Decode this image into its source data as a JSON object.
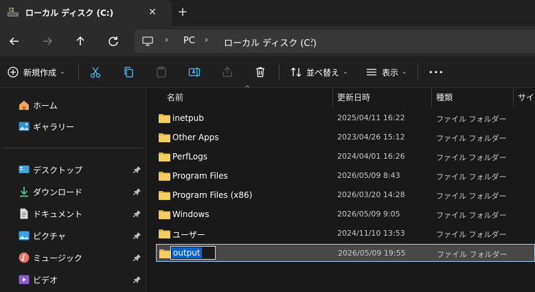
{
  "tab": {
    "title": "ローカル ディスク (C:)",
    "close_glyph": "✕",
    "new_tab_glyph": "+"
  },
  "address": {
    "crumbs": [
      "PC",
      "ローカル ディスク (C:)"
    ],
    "sep": "›"
  },
  "commands": {
    "new_label": "新規作成",
    "sort_label": "並べ替え",
    "view_label": "表示",
    "more_glyph": "•••",
    "caret": "⌄"
  },
  "sidebar": {
    "items": [
      {
        "label": "ホーム",
        "icon": "home-icon",
        "pinned": false
      },
      {
        "label": "ギャラリー",
        "icon": "gallery-icon",
        "pinned": false
      },
      {
        "label": "デスクトップ",
        "icon": "desktop-icon",
        "pinned": true
      },
      {
        "label": "ダウンロード",
        "icon": "download-icon",
        "pinned": true
      },
      {
        "label": "ドキュメント",
        "icon": "document-icon",
        "pinned": true
      },
      {
        "label": "ピクチャ",
        "icon": "pictures-icon",
        "pinned": true
      },
      {
        "label": "ミュージック",
        "icon": "music-icon",
        "pinned": true
      },
      {
        "label": "ビデオ",
        "icon": "video-icon",
        "pinned": true
      }
    ]
  },
  "columns": {
    "name": "名前",
    "modified": "更新日時",
    "type": "種類",
    "size": "サイズ",
    "sort_glyph": "^"
  },
  "files": [
    {
      "name": "inetpub",
      "modified": "2025/04/11 16:22",
      "type": "ファイル フォルダー"
    },
    {
      "name": "Other Apps",
      "modified": "2023/04/26 15:12",
      "type": "ファイル フォルダー"
    },
    {
      "name": "PerfLogs",
      "modified": "2024/04/01 16:26",
      "type": "ファイル フォルダー"
    },
    {
      "name": "Program Files",
      "modified": "2026/05/09 8:43",
      "type": "ファイル フォルダー"
    },
    {
      "name": "Program Files (x86)",
      "modified": "2026/03/20 14:28",
      "type": "ファイル フォルダー"
    },
    {
      "name": "Windows",
      "modified": "2026/05/09 9:05",
      "type": "ファイル フォルダー"
    },
    {
      "name": "ユーザー",
      "modified": "2024/11/10 13:53",
      "type": "ファイル フォルダー"
    }
  ],
  "renaming": {
    "value": "output",
    "modified": "2026/05/09 19:55",
    "type": "ファイル フォルダー"
  },
  "colors": {
    "folder": "#f2c94c",
    "accent": "#4cc2ff",
    "selection": "#0a63c9"
  }
}
